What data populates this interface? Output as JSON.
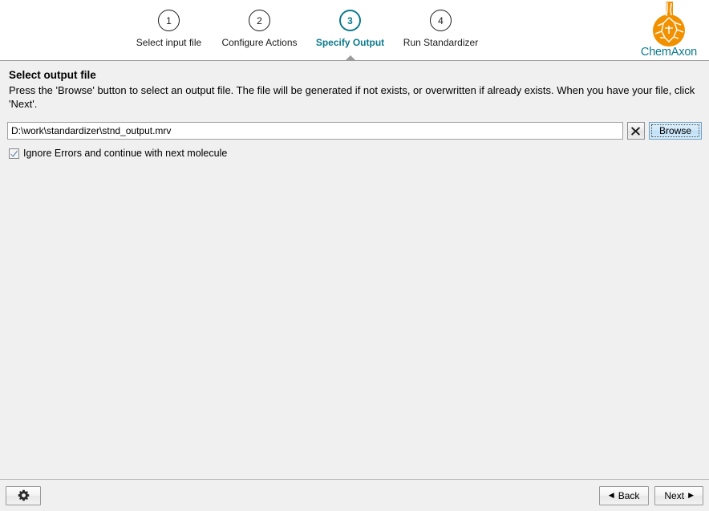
{
  "wizard": {
    "steps": [
      {
        "number": "1",
        "label": "Select input file",
        "active": false
      },
      {
        "number": "2",
        "label": "Configure Actions",
        "active": false
      },
      {
        "number": "3",
        "label": "Specify Output",
        "active": true
      },
      {
        "number": "4",
        "label": "Run Standardizer",
        "active": false
      }
    ],
    "active_color": "#0d7a8c",
    "inactive_color": "#1a1a1a"
  },
  "logo": {
    "name": "chemaxon-logo",
    "text": "ChemAxon",
    "flask_color": "#f29100",
    "text_color": "#0d7a8c"
  },
  "page": {
    "title": "Select output file",
    "description": "Press the 'Browse' button to select an output file. The file will be generated if not exists, or overwritten if already exists. When you have your file, click 'Next'."
  },
  "output_file": {
    "path_value": "D:\\work\\standardizer\\stnd_output.mrv",
    "path_placeholder": "",
    "clear_icon": "close-x-icon",
    "browse_label": "Browse"
  },
  "options": {
    "ignore_errors": {
      "label": "Ignore Errors and continue with next molecule",
      "checked": true
    }
  },
  "footer": {
    "settings_icon": "gear-icon",
    "back_label": "Back",
    "next_label": "Next",
    "back_arrow": "◀",
    "next_arrow": "▶"
  }
}
